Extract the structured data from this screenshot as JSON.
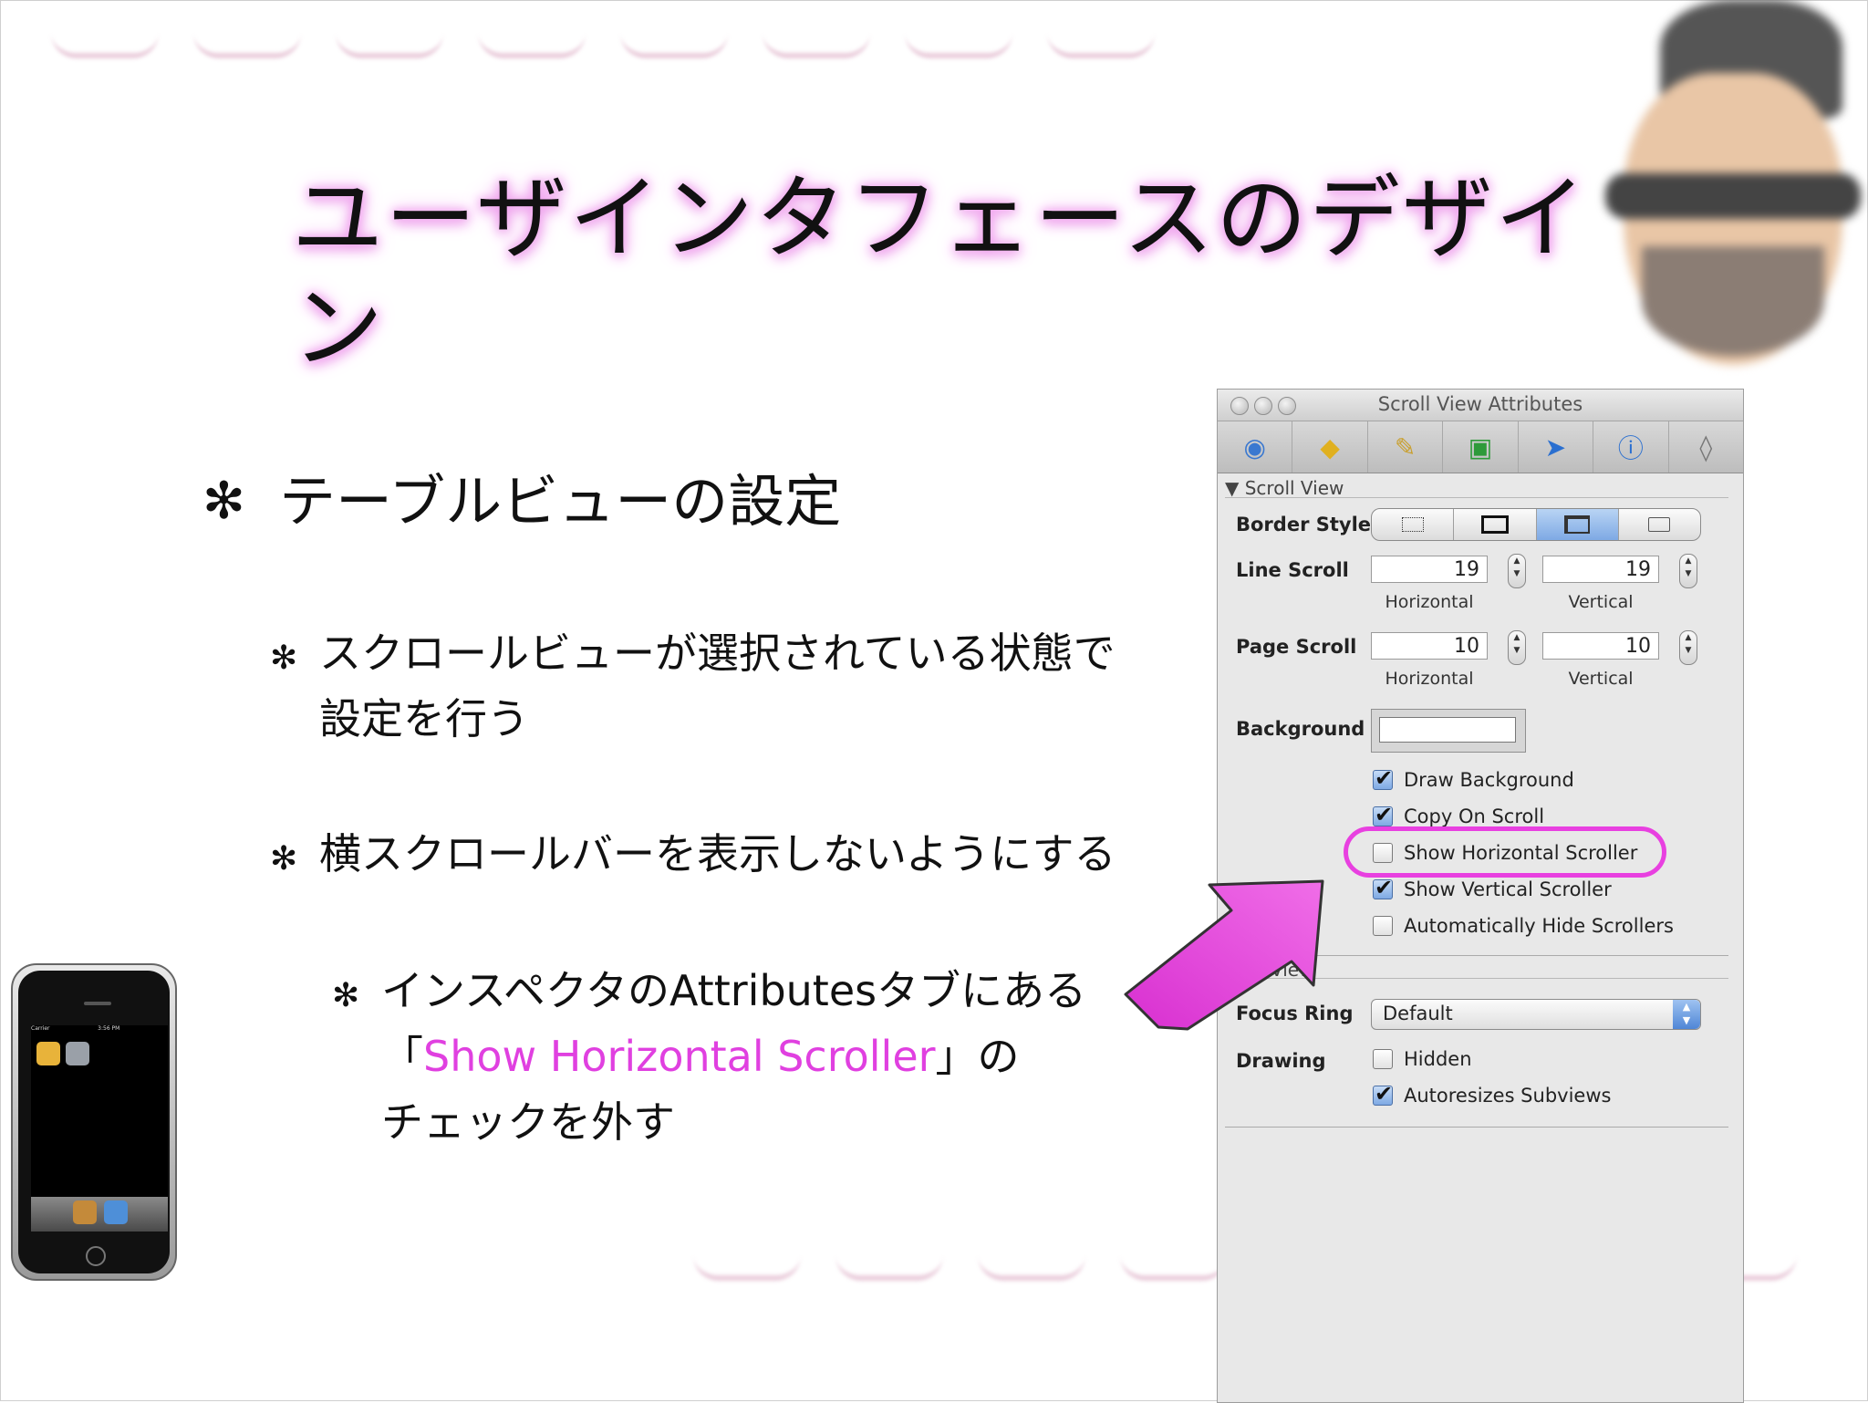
{
  "slide": {
    "title": "ユーザインタフェースのデザイン",
    "bullet1": {
      "mark": "✻",
      "text": "テーブルビューの設定"
    },
    "bullet2": {
      "mark": "✻",
      "line1": "スクロールビューが選択されている状態で",
      "line2": "設定を行う"
    },
    "bullet3": {
      "mark": "✻",
      "text": "横スクロールバーを表示しないようにする"
    },
    "bullet4": {
      "mark": "✻",
      "line1": "インスペクタのAttributesタブにある",
      "quote_open": "「",
      "highlight": "Show Horizontal Scroller",
      "quote_close": "」の",
      "line3": "チェックを外す"
    },
    "accent_color": "#e040e0"
  },
  "iphone": {
    "carrier": "Carrier",
    "time": "3:56 PM"
  },
  "inspector": {
    "window_title": "Scroll View Attributes",
    "toolbar_icons": [
      "attributes-icon",
      "effects-icon",
      "size-icon",
      "connections-icon",
      "bindings-icon",
      "info-icon",
      "applescript-icon"
    ],
    "section_scroll_view": "▼ Scroll View",
    "border_style_label": "Border Style",
    "line_scroll_label": "Line Scroll",
    "line_scroll_horizontal": "19",
    "line_scroll_vertical": "19",
    "page_scroll_label": "Page Scroll",
    "page_scroll_horizontal": "10",
    "page_scroll_vertical": "10",
    "horizontal_label": "Horizontal",
    "vertical_label": "Vertical",
    "background_label": "Background",
    "draw_background": "Draw Background",
    "copy_on_scroll": "Copy On Scroll",
    "show_horizontal_scroller": "Show Horizontal Scroller",
    "show_vertical_scroller": "Show Vertical Scroller",
    "auto_hide_scrollers": "Automatically Hide Scrollers",
    "section_view": "View",
    "focus_ring_label": "Focus Ring",
    "focus_ring_value": "Default",
    "drawing_label": "Drawing",
    "hidden_label": "Hidden",
    "autoresizes_label": "Autoresizes Subviews",
    "checks": {
      "draw_background": true,
      "copy_on_scroll": true,
      "show_horizontal_scroller": false,
      "show_vertical_scroller": true,
      "auto_hide_scrollers": false,
      "hidden": false,
      "autoresizes": true
    },
    "highlight_color": "#e840e0"
  }
}
